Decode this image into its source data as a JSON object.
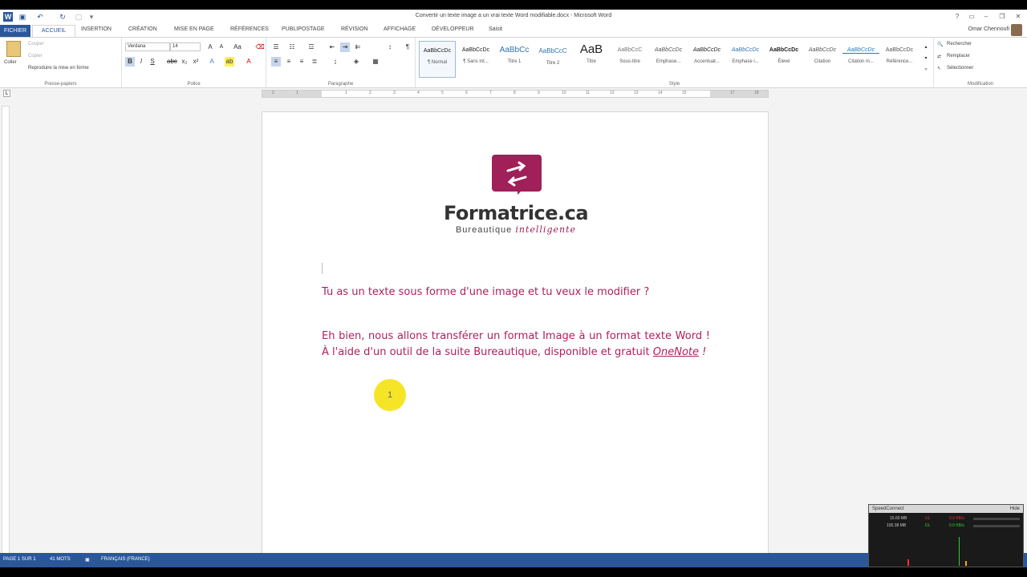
{
  "window": {
    "title": "Convertir un texte image a un vrai texte Word modifiable.docx - Microsoft Word"
  },
  "tabs": [
    "ACCUEIL",
    "INSERTION",
    "CRÉATION",
    "MISE EN PAGE",
    "RÉFÉRENCES",
    "PUBLIPOSTAGE",
    "RÉVISION",
    "AFFICHAGE",
    "DÉVELOPPEUR",
    "Saisit"
  ],
  "file_tab": "FICHIER",
  "user": {
    "name": "Omar Chennoufi"
  },
  "clipboard": {
    "paste": "Coller",
    "cut": "Couper",
    "copy": "Copier",
    "format_painter": "Reproduire la mise en forme",
    "label": "Presse-papiers"
  },
  "font": {
    "name": "Verdana",
    "size": "14",
    "label": "Police"
  },
  "paragraph": {
    "label": "Paragraphe"
  },
  "styles": {
    "label": "Style",
    "items": [
      {
        "sample": "AaBbCcDc",
        "name": "¶ Normal"
      },
      {
        "sample": "AaBbCcDc",
        "name": "¶ Sans int..."
      },
      {
        "sample": "AaBbCc",
        "name": "Titre 1"
      },
      {
        "sample": "AaBbCcC",
        "name": "Titre 2"
      },
      {
        "sample": "AaB",
        "name": "Titre"
      },
      {
        "sample": "AaBbCcC",
        "name": "Sous-titre"
      },
      {
        "sample": "AaBbCcDc",
        "name": "Emphase..."
      },
      {
        "sample": "AaBbCcDc",
        "name": "Accentuat..."
      },
      {
        "sample": "AaBbCcDc",
        "name": "Emphase i..."
      },
      {
        "sample": "AaBbCcDc",
        "name": "Élevé"
      },
      {
        "sample": "AaBbCcDc",
        "name": "Citation"
      },
      {
        "sample": "AaBbCcDc",
        "name": "Citation in..."
      },
      {
        "sample": "AaBbCcDc",
        "name": "Référence..."
      }
    ]
  },
  "editing": {
    "find": "Rechercher",
    "replace": "Remplacer",
    "select": "Sélectionner",
    "label": "Modification"
  },
  "ruler": {
    "numbers": [
      "2",
      "1",
      "1",
      "2",
      "3",
      "4",
      "5",
      "6",
      "7",
      "8",
      "9",
      "10",
      "11",
      "12",
      "13",
      "14",
      "15",
      "17",
      "18"
    ]
  },
  "document": {
    "brand": "Formatrice.ca",
    "tagline_plain": "Bureautique",
    "tagline_script": "intelligente",
    "para1": "Tu as un texte sous forme d'une image et tu veux le modifier ?",
    "para2_a": "Eh bien, nous allons transférer un format Image à un format texte Word ! À l'aide d'un outil de la suite Bureautique, disponible et gratuit ",
    "para2_link": "OneNote",
    "para2_end": " !",
    "marker": "1"
  },
  "status": {
    "page": "PAGE 1 SUR 1",
    "words": "41 MOTS",
    "lang": "FRANÇAIS (FRANCE)"
  },
  "speed_widget": {
    "title": "SpeedConnect",
    "hide": "Hide",
    "ul_label": "UL",
    "dl_label": "DL",
    "ul_total": "15.60 MB",
    "dl_total": "100.38 MB",
    "ul_rate": "0.0 KB/s",
    "dl_rate": "0.0 KB/s"
  },
  "colors": {
    "accent": "#2b579a",
    "brand": "#a02059",
    "text": "#b0205e"
  }
}
